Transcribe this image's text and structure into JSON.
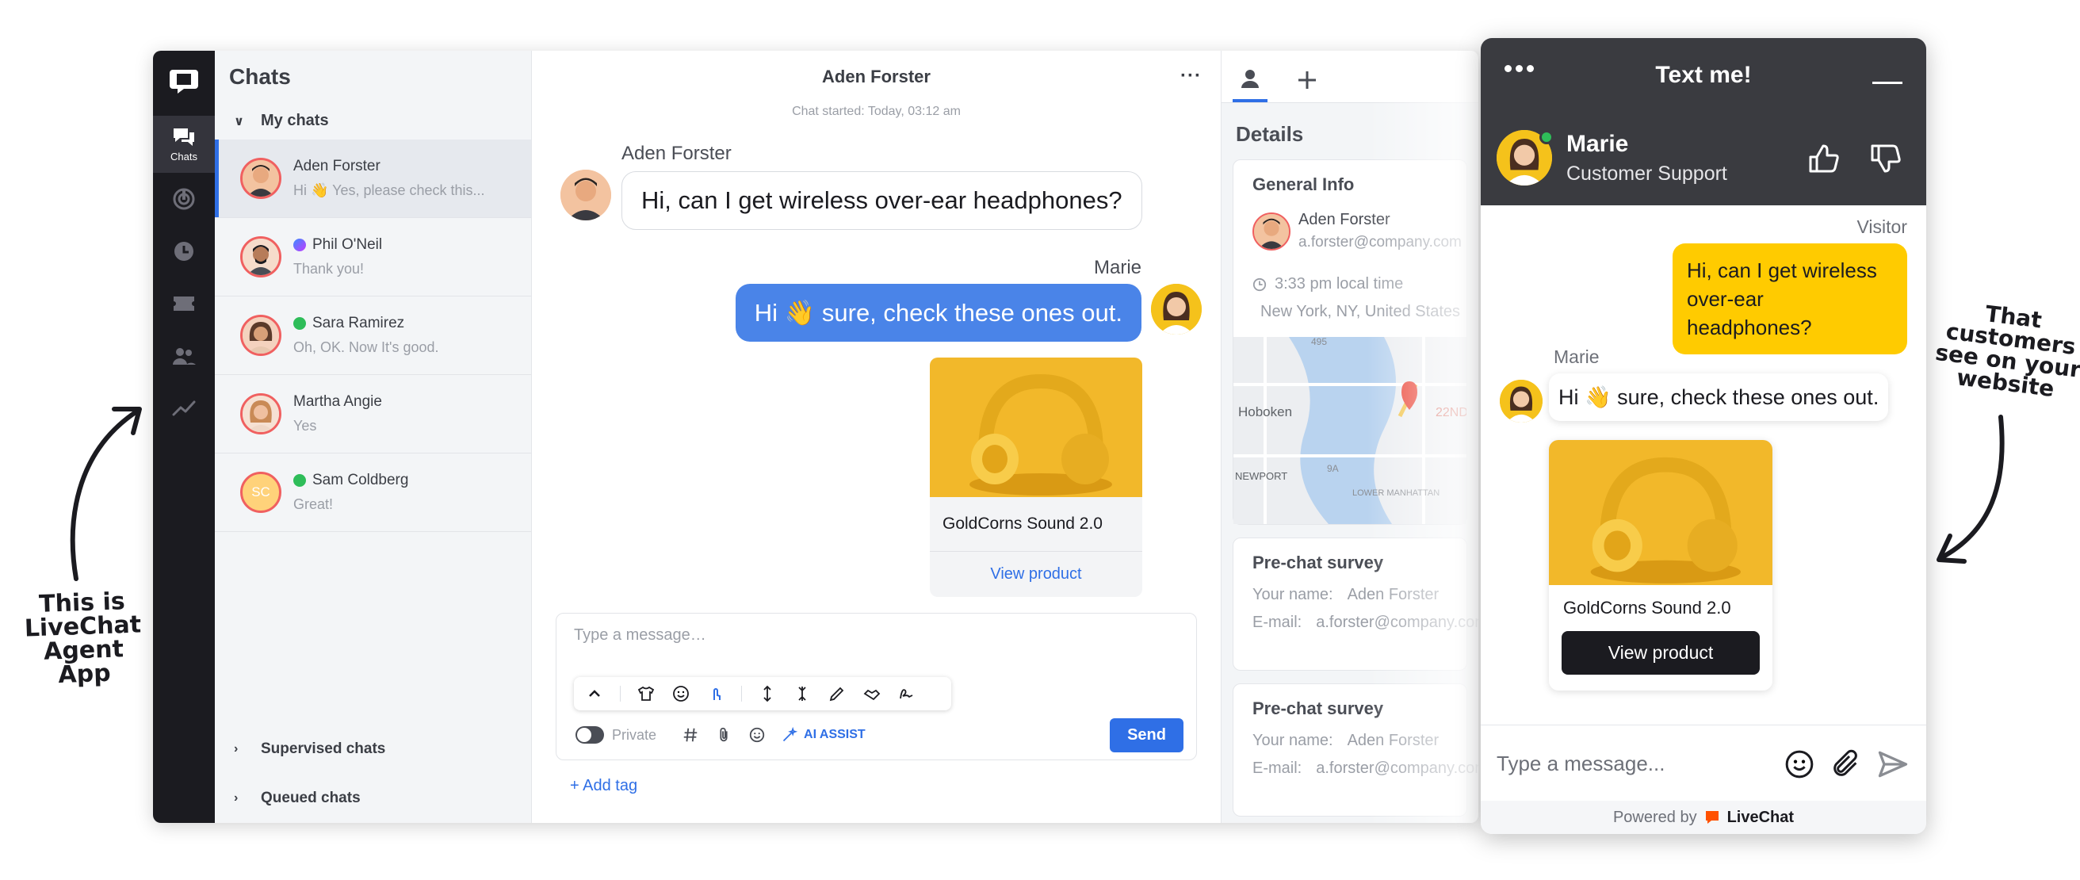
{
  "annotations": {
    "left_note": "This is LiveChat Agent App",
    "right_note": "That customers see on your website"
  },
  "agent_app": {
    "rail": {
      "active_label": "Chats",
      "icons": [
        "livechat-logo-icon",
        "chats-icon",
        "engage-icon",
        "archives-icon",
        "tickets-icon",
        "team-icon",
        "reports-icon"
      ]
    },
    "chat_list": {
      "title": "Chats",
      "my_chats_label": "My chats",
      "chats": [
        {
          "name": "Aden Forster",
          "snippet": "Hi 👋 Yes, please check this...",
          "active": true,
          "channel": ""
        },
        {
          "name": "Phil O'Neil",
          "snippet": "Thank you!",
          "active": false,
          "channel": "messenger"
        },
        {
          "name": "Sara Ramirez",
          "snippet": "Oh, OK. Now It's good.",
          "active": false,
          "channel": "whatsapp"
        },
        {
          "name": "Martha Angie",
          "snippet": "Yes",
          "active": false,
          "channel": ""
        },
        {
          "name": "Sam Coldberg",
          "snippet": "Great!",
          "active": false,
          "channel": "whatsapp",
          "initials": "SC"
        }
      ],
      "supervised_label": "Supervised chats",
      "queued_label": "Queued chats"
    },
    "conversation": {
      "header_name": "Aden Forster",
      "more_label": "···",
      "chat_started": "Chat started: Today, 03:12 am",
      "incoming_name": "Aden Forster",
      "incoming_text": "Hi, can I get wireless over-ear headphones?",
      "outgoing_name": "Marie",
      "outgoing_text": "Hi 👋 sure, check these ones out.",
      "product_title": "GoldCorns Sound 2.0",
      "product_link": "View product",
      "composer_placeholder": "Type a message…",
      "private_label": "Private",
      "ai_assist_label": "AI ASSIST",
      "send_label": "Send",
      "add_tag_label": "+ Add tag"
    },
    "details": {
      "title": "Details",
      "general_info_title": "General Info",
      "customer_name": "Aden Forster",
      "customer_email": "a.forster@company.com",
      "local_time": "3:33 pm local time",
      "location": "New York, NY, United States",
      "map_labels": [
        "Hoboken",
        "NEWPORT",
        "LOWER MANHATTAN",
        "495",
        "9A",
        "22ND"
      ],
      "surveys": [
        {
          "title": "Pre-chat survey",
          "name_label": "Your name:",
          "name_value": "Aden Forster",
          "email_label": "E-mail:",
          "email_value": "a.forster@company.com"
        },
        {
          "title": "Pre-chat survey",
          "name_label": "Your name:",
          "name_value": "Aden Forster",
          "email_label": "E-mail:",
          "email_value": "a.forster@company.com"
        }
      ]
    }
  },
  "widget": {
    "title": "Text me!",
    "agent_name": "Marie",
    "agent_role": "Customer Support",
    "visitor_label": "Visitor",
    "visitor_text": "Hi, can I get wireless over-ear headphones?",
    "agent_label": "Marie",
    "agent_text": "Hi 👋 sure, check these ones out.",
    "product_title": "GoldCorns Sound 2.0",
    "product_button": "View product",
    "composer_placeholder": "Type a message...",
    "powered_by": "Powered by",
    "brand": "LiveChat"
  },
  "colors": {
    "accent_blue": "#2f6fe6",
    "bubble_blue": "#4a84e8",
    "visitor_yellow": "#ffcb00",
    "rail_dark": "#1b1b20",
    "widget_header": "#3a3b40",
    "brand_orange": "#ff5100",
    "online_green": "#2ebd59"
  }
}
